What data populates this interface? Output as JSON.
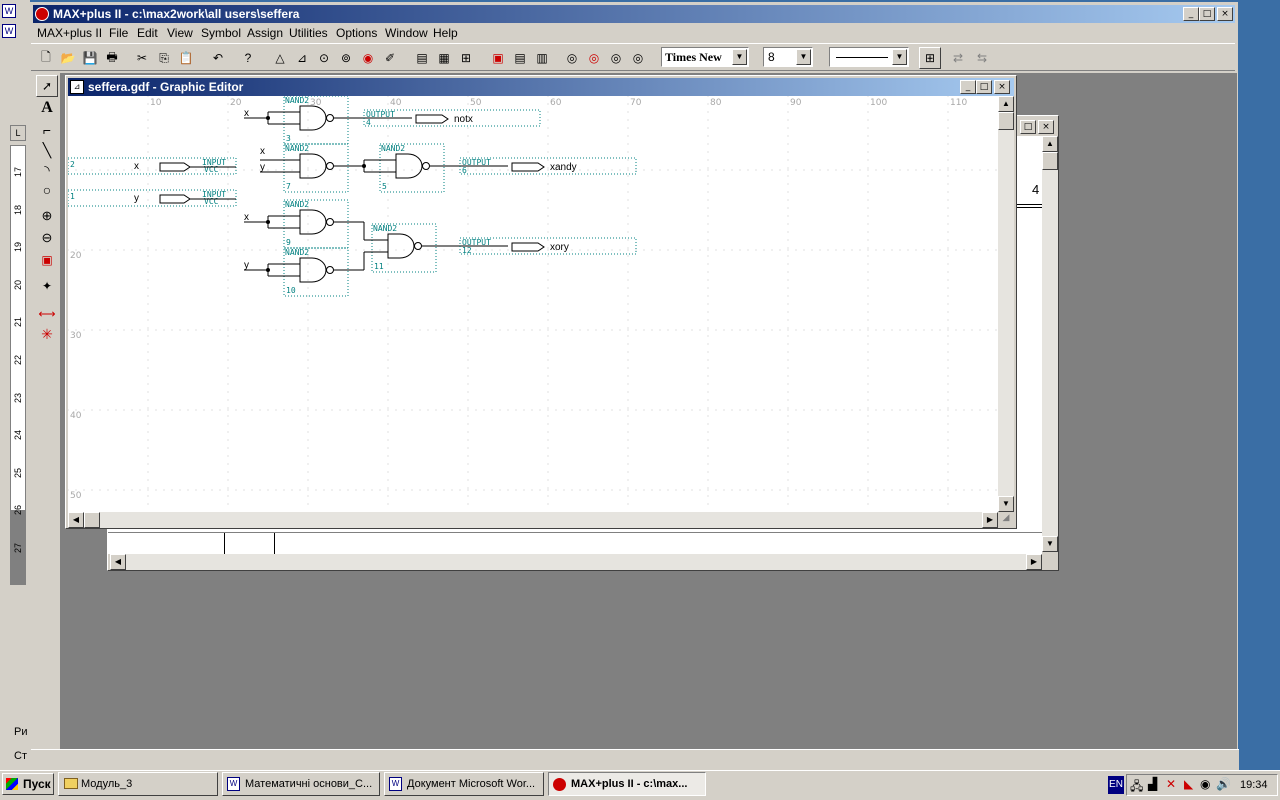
{
  "app": {
    "title": "MAX+plus II - c:\\max2work\\all users\\seffera",
    "menu": [
      "MAX+plus II",
      "File",
      "Edit",
      "View",
      "Symbol",
      "Assign",
      "Utilities",
      "Options",
      "Window",
      "Help"
    ],
    "font_select": "Times New",
    "size_select": "8",
    "caption_buttons": [
      "_",
      "□",
      "×"
    ]
  },
  "editor": {
    "title": "seffera.gdf - Graphic Editor",
    "ruler_top": [
      "10",
      "20",
      "30",
      "40",
      "50",
      "60",
      "70",
      "80",
      "90",
      "100",
      "110"
    ],
    "ruler_left": [
      "20",
      "30",
      "40",
      "50"
    ],
    "gate_type": "NAND2",
    "input_type": "INPUT",
    "output_type": "OUTPUT",
    "vcc": "VCC",
    "pins": {
      "x_in": "x",
      "y_in": "y",
      "in_num_x": "2",
      "in_num_y": "1",
      "out_notx": "notx",
      "out_xandy": "xandy",
      "out_xory": "xory",
      "out_num_notx": "4",
      "out_num_xandy": "6",
      "out_num_xory": "12"
    },
    "gate_numbers": [
      "3",
      "7",
      "5",
      "9",
      "10",
      "11"
    ],
    "port_x": "x",
    "port_y": "y"
  },
  "back_window": {
    "visible_digit": "4"
  },
  "word_ruler": [
    "17",
    "18",
    "19",
    "20",
    "21",
    "22",
    "23",
    "24",
    "25",
    "26",
    "27"
  ],
  "word_side": {
    "status_left": "Ст",
    "draw_label": "Ри"
  },
  "taskbar": {
    "start": "Пуск",
    "items": [
      "Модуль_3",
      "Математичні основи_С...",
      "Документ Microsoft Wor...",
      "MAX+plus II - c:\\max..."
    ],
    "lang": "EN",
    "clock": "19:34"
  },
  "colors": {
    "titlebar": "#0a246a",
    "titlebar2": "#a6caf0",
    "teal": "#008080",
    "workspace": "#808080"
  }
}
